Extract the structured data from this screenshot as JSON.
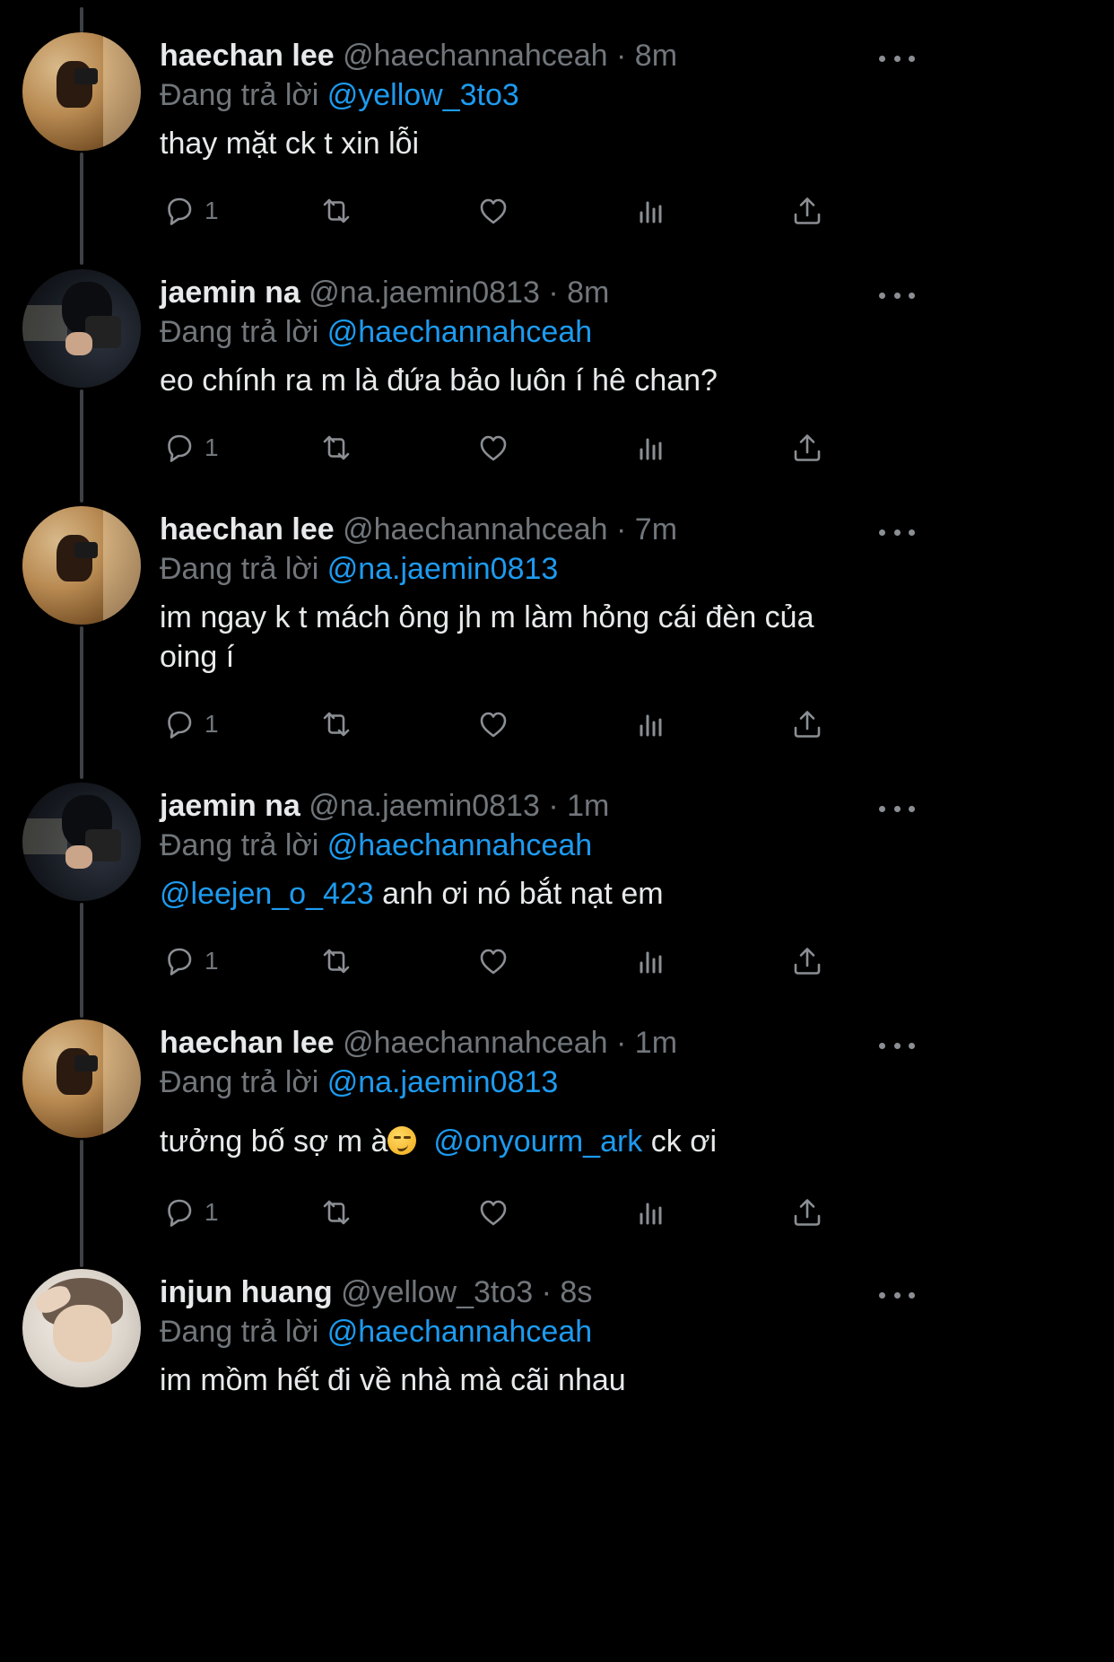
{
  "replying_prefix": "Đang trả lời",
  "tweets": [
    {
      "name": "haechan lee",
      "handle": "@haechannahceah",
      "separator": "·",
      "time": "8m",
      "replying_to": "@yellow_3to3",
      "text": "thay mặt ck t xin lỗi",
      "reply_count": "1",
      "avatar_style": "warm"
    },
    {
      "name": "jaemin na",
      "handle": "@na.jaemin0813",
      "separator": "·",
      "time": "8m",
      "replying_to": "@haechannahceah",
      "text": "eo chính ra m là đứa bảo luôn í hê chan?",
      "reply_count": "1",
      "avatar_style": "dark"
    },
    {
      "name": "haechan lee",
      "handle": "@haechannahceah",
      "separator": "·",
      "time": "7m",
      "replying_to": "@na.jaemin0813",
      "text_line1": "im ngay k t mách ông jh m làm hỏng cái đèn của",
      "text_line2": "oing í",
      "reply_count": "1",
      "avatar_style": "warm"
    },
    {
      "name": "jaemin na",
      "handle": "@na.jaemin0813",
      "separator": "·",
      "time": "1m",
      "replying_to": "@haechannahceah",
      "text_mention": "@leejen_o_423",
      "text_rest": " anh ơi nó bắt nạt em",
      "reply_count": "1",
      "avatar_style": "dark"
    },
    {
      "name": "haechan lee",
      "handle": "@haechannahceah",
      "separator": "·",
      "time": "1m",
      "replying_to": "@na.jaemin0813",
      "text_before": "tưởng bố sợ m à",
      "emoji_name": "smirking-face-emoji",
      "text_mention": "@onyourm_ark",
      "text_after": " ck ơi",
      "reply_count": "1",
      "avatar_style": "warm"
    },
    {
      "name": "injun huang",
      "handle": "@yellow_3to3",
      "separator": "·",
      "time": "8s",
      "replying_to": "@haechannahceah",
      "text": "im mồm hết đi về nhà mà cãi nhau",
      "avatar_style": "light"
    }
  ],
  "icons": {
    "reply": "reply-icon",
    "retweet": "retweet-icon",
    "like": "heart-icon",
    "views": "views-icon",
    "share": "share-icon",
    "more": "more-icon"
  },
  "colors": {
    "background": "#000000",
    "primary_text": "#e7e9ea",
    "secondary_text": "#71767b",
    "accent": "#1d9bf0",
    "thread_line": "#3e4144"
  }
}
